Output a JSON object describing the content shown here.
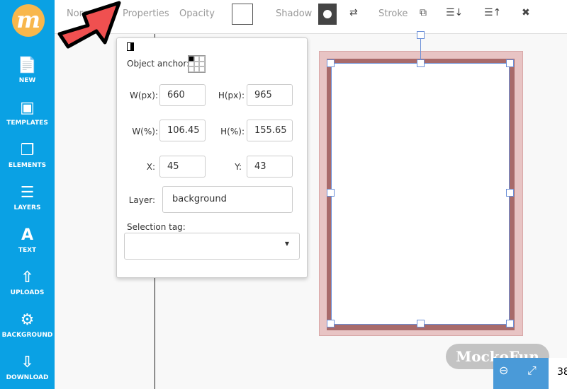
{
  "sidebar": {
    "logo": "m",
    "items": [
      {
        "label": "NEW",
        "icon": "file-icon"
      },
      {
        "label": "TEMPLATES",
        "icon": "templates-icon"
      },
      {
        "label": "ELEMENTS",
        "icon": "cubes-icon"
      },
      {
        "label": "LAYERS",
        "icon": "layers-icon"
      },
      {
        "label": "TEXT",
        "icon": "text-icon"
      },
      {
        "label": "UPLOADS",
        "icon": "upload-icon"
      },
      {
        "label": "BACKGROUND",
        "icon": "gear-icon"
      },
      {
        "label": "DOWNLOAD",
        "icon": "download-icon"
      }
    ]
  },
  "toolbar": {
    "normal": "Normal",
    "properties": "Properties",
    "opacity": "Opacity",
    "shadow": "Shadow",
    "stroke": "Stroke"
  },
  "panel": {
    "anchor_label": "Object anchor:",
    "w_px_label": "W(px):",
    "w_px": "660",
    "h_px_label": "H(px):",
    "h_px": "965",
    "w_pct_label": "W(%):",
    "w_pct": "106.45",
    "h_pct_label": "H(%):",
    "h_pct": "155.65",
    "x_label": "X:",
    "x": "45",
    "y_label": "Y:",
    "y": "43",
    "layer_label": "Layer:",
    "layer": "background",
    "tag_label": "Selection tag:",
    "tag": ""
  },
  "watermark": "MockoFun",
  "zoom": {
    "value": "38"
  },
  "colors": {
    "sidebar": "#0aa1e4",
    "logo": "#f8b74c",
    "arrow": "#f05050",
    "zoom": "#4a9ad8"
  }
}
